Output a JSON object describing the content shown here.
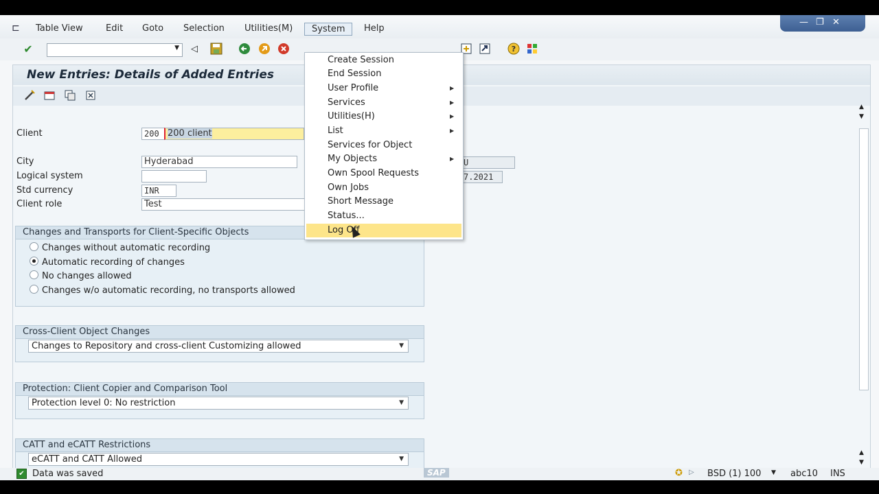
{
  "menubar": {
    "items": [
      "Table View",
      "Edit",
      "Goto",
      "Selection",
      "Utilities(M)",
      "System",
      "Help"
    ]
  },
  "window_controls": {
    "minimize": "—",
    "restore": "❐",
    "close": "✕"
  },
  "toolbar": {
    "command_value": ""
  },
  "page": {
    "title": "New Entries: Details of Added Entries"
  },
  "fields": {
    "client_label": "Client",
    "client_value": "200",
    "client_desc": "200 client",
    "city_label": "City",
    "city_value": "Hyderabad",
    "logical_system_label": "Logical system",
    "logical_system_value": "",
    "std_currency_label": "Std currency",
    "std_currency_value": "INR",
    "client_role_label": "Client role",
    "client_role_value": "Test",
    "partial_user_value": "U",
    "partial_date_value": "7.2021"
  },
  "groups": {
    "changes_transports": {
      "title": "Changes and Transports for Client-Specific Objects",
      "options": [
        "Changes without automatic recording",
        "Automatic recording of changes",
        "No changes allowed",
        "Changes w/o automatic recording, no transports allowed"
      ],
      "selected_index": 1
    },
    "cross_client": {
      "title": "Cross-Client Object Changes",
      "selected": "Changes to Repository and cross-client Customizing allowed"
    },
    "protection": {
      "title": "Protection: Client Copier and Comparison Tool",
      "selected": "Protection level 0: No restriction"
    },
    "catt": {
      "title": "CATT and eCATT Restrictions",
      "selected": "eCATT and CATT Allowed"
    }
  },
  "system_menu": {
    "items": [
      {
        "label": "Create Session",
        "submenu": false
      },
      {
        "label": "End Session",
        "submenu": false
      },
      {
        "label": "User Profile",
        "submenu": true
      },
      {
        "label": "Services",
        "submenu": true
      },
      {
        "label": "Utilities(H)",
        "submenu": true
      },
      {
        "label": "List",
        "submenu": true
      },
      {
        "label": "Services for Object",
        "submenu": false
      },
      {
        "label": "My Objects",
        "submenu": true
      },
      {
        "label": "Own Spool Requests",
        "submenu": false
      },
      {
        "label": "Own Jobs",
        "submenu": false
      },
      {
        "label": "Short Message",
        "submenu": false
      },
      {
        "label": "Status...",
        "submenu": false
      },
      {
        "label": "Log Off",
        "submenu": false
      }
    ],
    "highlighted_index": 12
  },
  "statusbar": {
    "message": "Data was saved",
    "system": "BSD (1) 100",
    "server": "abc10",
    "mode": "INS",
    "logo": "SAP"
  },
  "colors": {
    "menu_highlight": "#fde58a",
    "selected_text_bg": "#c8d6e3",
    "client_field_bg": "#fcef9e",
    "success_green": "#2f8a2f"
  }
}
